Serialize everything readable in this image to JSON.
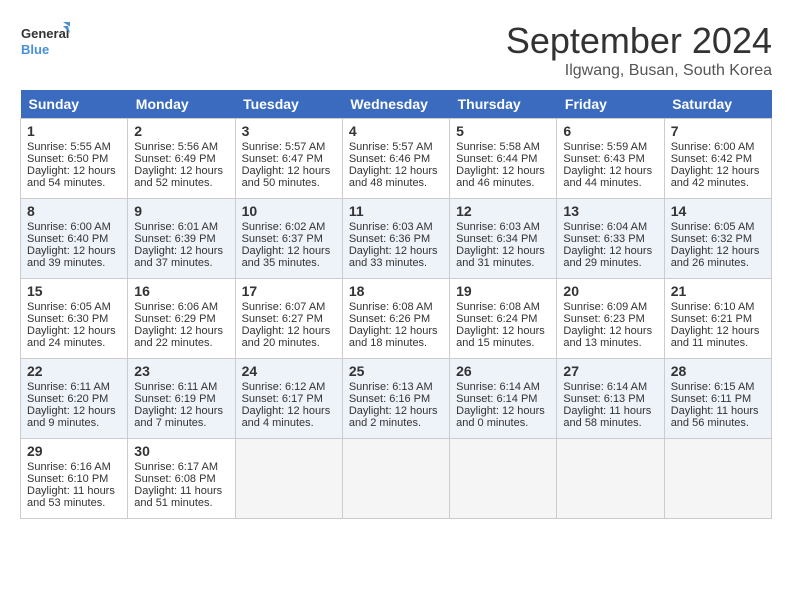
{
  "header": {
    "logo_line1": "General",
    "logo_line2": "Blue",
    "month_title": "September 2024",
    "location": "Ilgwang, Busan, South Korea"
  },
  "days_of_week": [
    "Sunday",
    "Monday",
    "Tuesday",
    "Wednesday",
    "Thursday",
    "Friday",
    "Saturday"
  ],
  "weeks": [
    [
      {
        "day": "1",
        "lines": [
          "Sunrise: 5:55 AM",
          "Sunset: 6:50 PM",
          "Daylight: 12 hours",
          "and 54 minutes."
        ]
      },
      {
        "day": "2",
        "lines": [
          "Sunrise: 5:56 AM",
          "Sunset: 6:49 PM",
          "Daylight: 12 hours",
          "and 52 minutes."
        ]
      },
      {
        "day": "3",
        "lines": [
          "Sunrise: 5:57 AM",
          "Sunset: 6:47 PM",
          "Daylight: 12 hours",
          "and 50 minutes."
        ]
      },
      {
        "day": "4",
        "lines": [
          "Sunrise: 5:57 AM",
          "Sunset: 6:46 PM",
          "Daylight: 12 hours",
          "and 48 minutes."
        ]
      },
      {
        "day": "5",
        "lines": [
          "Sunrise: 5:58 AM",
          "Sunset: 6:44 PM",
          "Daylight: 12 hours",
          "and 46 minutes."
        ]
      },
      {
        "day": "6",
        "lines": [
          "Sunrise: 5:59 AM",
          "Sunset: 6:43 PM",
          "Daylight: 12 hours",
          "and 44 minutes."
        ]
      },
      {
        "day": "7",
        "lines": [
          "Sunrise: 6:00 AM",
          "Sunset: 6:42 PM",
          "Daylight: 12 hours",
          "and 42 minutes."
        ]
      }
    ],
    [
      {
        "day": "8",
        "lines": [
          "Sunrise: 6:00 AM",
          "Sunset: 6:40 PM",
          "Daylight: 12 hours",
          "and 39 minutes."
        ]
      },
      {
        "day": "9",
        "lines": [
          "Sunrise: 6:01 AM",
          "Sunset: 6:39 PM",
          "Daylight: 12 hours",
          "and 37 minutes."
        ]
      },
      {
        "day": "10",
        "lines": [
          "Sunrise: 6:02 AM",
          "Sunset: 6:37 PM",
          "Daylight: 12 hours",
          "and 35 minutes."
        ]
      },
      {
        "day": "11",
        "lines": [
          "Sunrise: 6:03 AM",
          "Sunset: 6:36 PM",
          "Daylight: 12 hours",
          "and 33 minutes."
        ]
      },
      {
        "day": "12",
        "lines": [
          "Sunrise: 6:03 AM",
          "Sunset: 6:34 PM",
          "Daylight: 12 hours",
          "and 31 minutes."
        ]
      },
      {
        "day": "13",
        "lines": [
          "Sunrise: 6:04 AM",
          "Sunset: 6:33 PM",
          "Daylight: 12 hours",
          "and 29 minutes."
        ]
      },
      {
        "day": "14",
        "lines": [
          "Sunrise: 6:05 AM",
          "Sunset: 6:32 PM",
          "Daylight: 12 hours",
          "and 26 minutes."
        ]
      }
    ],
    [
      {
        "day": "15",
        "lines": [
          "Sunrise: 6:05 AM",
          "Sunset: 6:30 PM",
          "Daylight: 12 hours",
          "and 24 minutes."
        ]
      },
      {
        "day": "16",
        "lines": [
          "Sunrise: 6:06 AM",
          "Sunset: 6:29 PM",
          "Daylight: 12 hours",
          "and 22 minutes."
        ]
      },
      {
        "day": "17",
        "lines": [
          "Sunrise: 6:07 AM",
          "Sunset: 6:27 PM",
          "Daylight: 12 hours",
          "and 20 minutes."
        ]
      },
      {
        "day": "18",
        "lines": [
          "Sunrise: 6:08 AM",
          "Sunset: 6:26 PM",
          "Daylight: 12 hours",
          "and 18 minutes."
        ]
      },
      {
        "day": "19",
        "lines": [
          "Sunrise: 6:08 AM",
          "Sunset: 6:24 PM",
          "Daylight: 12 hours",
          "and 15 minutes."
        ]
      },
      {
        "day": "20",
        "lines": [
          "Sunrise: 6:09 AM",
          "Sunset: 6:23 PM",
          "Daylight: 12 hours",
          "and 13 minutes."
        ]
      },
      {
        "day": "21",
        "lines": [
          "Sunrise: 6:10 AM",
          "Sunset: 6:21 PM",
          "Daylight: 12 hours",
          "and 11 minutes."
        ]
      }
    ],
    [
      {
        "day": "22",
        "lines": [
          "Sunrise: 6:11 AM",
          "Sunset: 6:20 PM",
          "Daylight: 12 hours",
          "and 9 minutes."
        ]
      },
      {
        "day": "23",
        "lines": [
          "Sunrise: 6:11 AM",
          "Sunset: 6:19 PM",
          "Daylight: 12 hours",
          "and 7 minutes."
        ]
      },
      {
        "day": "24",
        "lines": [
          "Sunrise: 6:12 AM",
          "Sunset: 6:17 PM",
          "Daylight: 12 hours",
          "and 4 minutes."
        ]
      },
      {
        "day": "25",
        "lines": [
          "Sunrise: 6:13 AM",
          "Sunset: 6:16 PM",
          "Daylight: 12 hours",
          "and 2 minutes."
        ]
      },
      {
        "day": "26",
        "lines": [
          "Sunrise: 6:14 AM",
          "Sunset: 6:14 PM",
          "Daylight: 12 hours",
          "and 0 minutes."
        ]
      },
      {
        "day": "27",
        "lines": [
          "Sunrise: 6:14 AM",
          "Sunset: 6:13 PM",
          "Daylight: 11 hours",
          "and 58 minutes."
        ]
      },
      {
        "day": "28",
        "lines": [
          "Sunrise: 6:15 AM",
          "Sunset: 6:11 PM",
          "Daylight: 11 hours",
          "and 56 minutes."
        ]
      }
    ],
    [
      {
        "day": "29",
        "lines": [
          "Sunrise: 6:16 AM",
          "Sunset: 6:10 PM",
          "Daylight: 11 hours",
          "and 53 minutes."
        ]
      },
      {
        "day": "30",
        "lines": [
          "Sunrise: 6:17 AM",
          "Sunset: 6:08 PM",
          "Daylight: 11 hours",
          "and 51 minutes."
        ]
      },
      {
        "day": "",
        "lines": []
      },
      {
        "day": "",
        "lines": []
      },
      {
        "day": "",
        "lines": []
      },
      {
        "day": "",
        "lines": []
      },
      {
        "day": "",
        "lines": []
      }
    ]
  ]
}
